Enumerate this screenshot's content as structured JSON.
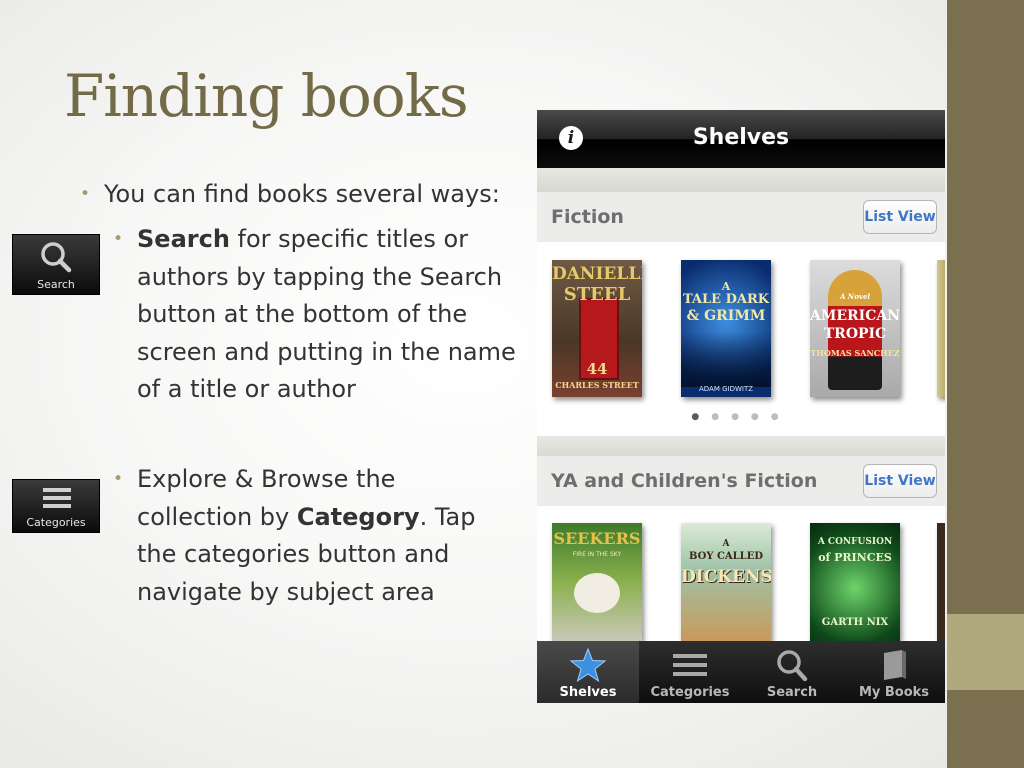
{
  "slide": {
    "title": "Finding books",
    "bullet1": "You can find books several ways:",
    "bullet2_bold": "Search",
    "bullet2_rest": " for specific titles or authors by tapping the Search button at the bottom of the screen and putting in the name of a title or author",
    "bullet3_pre": "Explore & Browse the collection by ",
    "bullet3_bold": "Category",
    "bullet3_rest": ". Tap the categories button and navigate by subject area",
    "search_button_label": "Search",
    "categories_button_label": "Categories"
  },
  "phone": {
    "nav_title": "Shelves",
    "info_glyph": "i",
    "shelves": [
      {
        "title": "Fiction",
        "list_view_label": "List View",
        "books": [
          {
            "line1": "DANIELLE",
            "line2": "STEEL",
            "line3": "44",
            "line4": "CHARLES STREET"
          },
          {
            "line1": "A",
            "line2": "TALE DARK",
            "line3": "& GRIMM",
            "line4": "ADAM GIDWITZ"
          },
          {
            "line1": "A Novel",
            "line2": "AMERICAN",
            "line3": "TROPIC",
            "line4": "THOMAS SANCHEZ"
          }
        ],
        "pages": 5,
        "current_page": 1
      },
      {
        "title": "YA and Children's Fiction",
        "list_view_label": "List View",
        "books": [
          {
            "line1": "SEEKERS",
            "line2": "FIRE IN THE SKY"
          },
          {
            "line1": "A",
            "line2": "BOY CALLED",
            "line3": "DICKENS"
          },
          {
            "line1": "A CONFUSION",
            "line2": "of PRINCES",
            "line3": "GARTH NIX"
          }
        ]
      }
    ],
    "tabs": [
      {
        "label": "Shelves",
        "icon": "star-icon",
        "active": true
      },
      {
        "label": "Categories",
        "icon": "list-icon",
        "active": false
      },
      {
        "label": "Search",
        "icon": "search-icon",
        "active": false
      },
      {
        "label": "My Books",
        "icon": "book-icon",
        "active": false
      }
    ]
  },
  "colors": {
    "title": "#736b47",
    "accent_bar": "#7a6f4f",
    "accent_bar_light": "#b0a97e",
    "list_view_blue": "#3f76c6",
    "active_tab_star": "#3e8fe0"
  }
}
